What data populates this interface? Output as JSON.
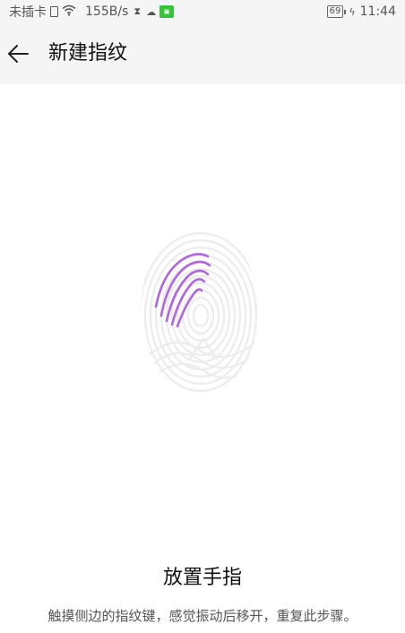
{
  "status_bar": {
    "carrier": "未插卡",
    "sim_icon": "sim-card-icon",
    "wifi_icon": "wifi-icon",
    "speed": "155B/s",
    "icons": [
      "hourglass-icon",
      "cloud-icon",
      "green-app-icon"
    ],
    "battery": "69",
    "charging_icon": "charging-bolt-icon",
    "time": "11:44"
  },
  "header": {
    "back_icon": "arrow-left-icon",
    "title": "新建指纹"
  },
  "fingerprint": {
    "icon": "fingerprint-icon",
    "progress_color": "#b066e3",
    "base_color": "#eeeeee"
  },
  "instructions": {
    "title": "放置手指",
    "text": "触摸侧边的指纹键，感觉振动后移开，重复此步骤。"
  }
}
